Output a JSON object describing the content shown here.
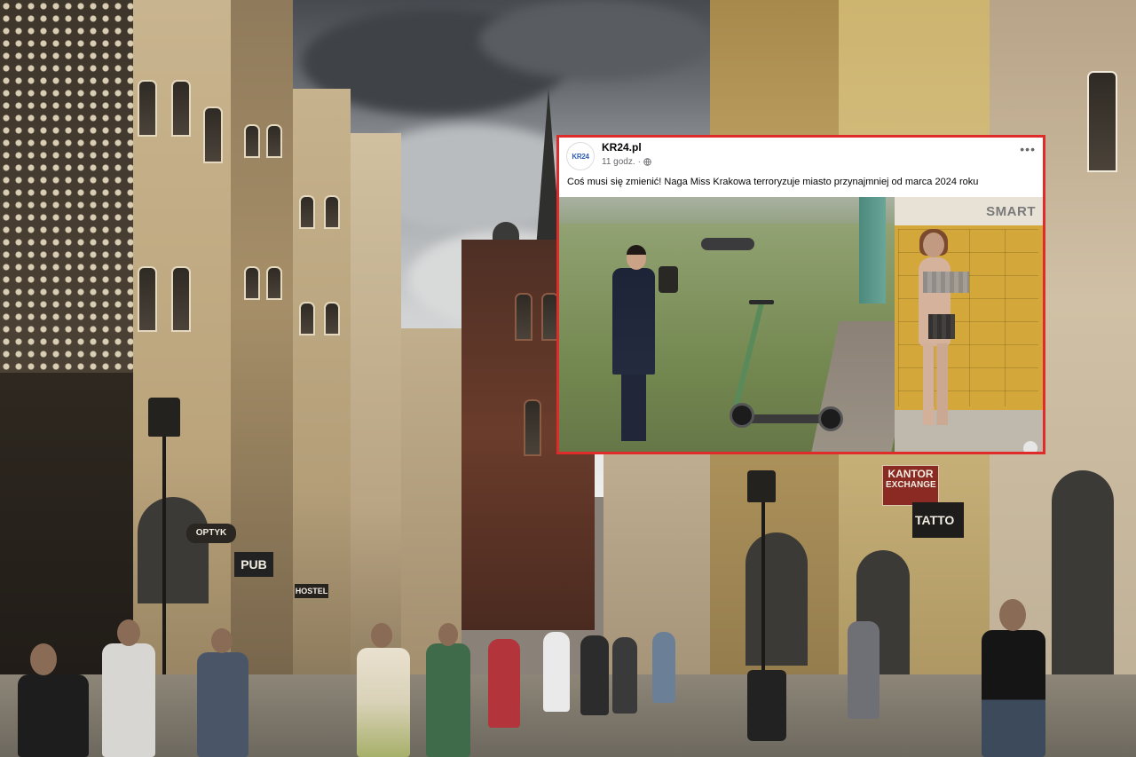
{
  "post": {
    "page_name": "KR24.pl",
    "avatar_text": "KR24",
    "time": "11 godz.",
    "text": "Coś musi się zmienić! Naga Miss Krakowa terroryzuje miasto przynajmniej od marca 2024 roku",
    "video": {
      "locker_brand": "SMART"
    }
  },
  "street_signs": {
    "kantor": "KANTOR",
    "exchange": "EXCHANGE",
    "tatto": "TATTO",
    "optyk": "OPTYK",
    "pub": "PUB",
    "hostel": "HOSTEL"
  },
  "colors": {
    "card_border": "#e02b2b",
    "avatar_text": "#2d5fb5",
    "meta_gray": "#65676b"
  }
}
